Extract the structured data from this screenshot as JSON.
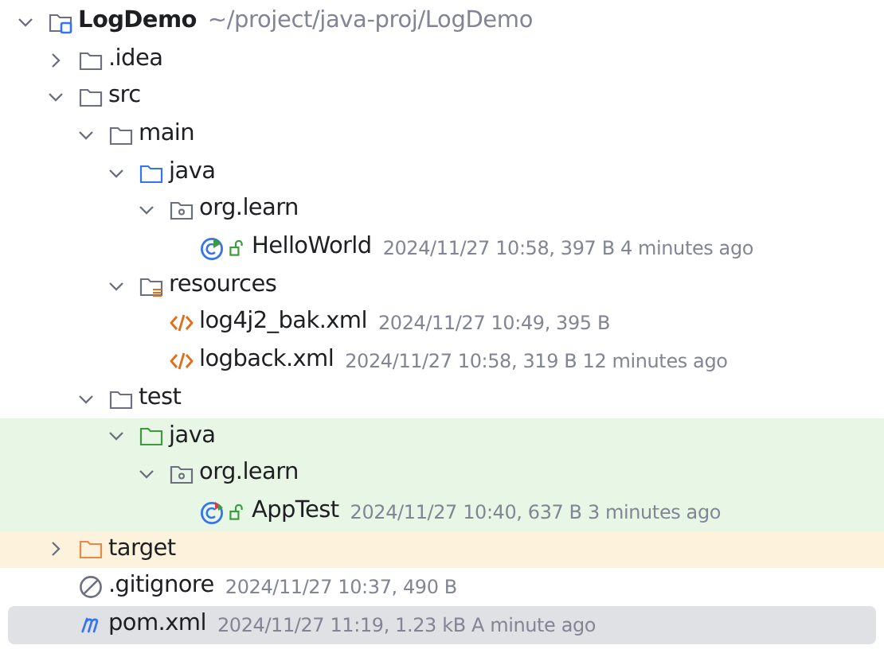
{
  "tree": [
    {
      "label": "LogDemo",
      "detail": "~/project/java-proj/LogDemo",
      "kind": "project",
      "expanded": true,
      "children": [
        {
          "label": ".idea",
          "kind": "folder",
          "expanded": false
        },
        {
          "label": "src",
          "kind": "folder",
          "expanded": true,
          "children": [
            {
              "label": "main",
              "kind": "folder",
              "expanded": true,
              "children": [
                {
                  "label": "java",
                  "kind": "source-folder",
                  "expanded": true,
                  "children": [
                    {
                      "label": "org.learn",
                      "kind": "package",
                      "expanded": true,
                      "children": [
                        {
                          "label": "HelloWorld",
                          "detail": "2024/11/27 10:58, 397 B 4 minutes ago",
                          "kind": "class"
                        }
                      ]
                    }
                  ]
                },
                {
                  "label": "resources",
                  "kind": "resources",
                  "expanded": true,
                  "children": [
                    {
                      "label": "log4j2_bak.xml",
                      "detail": "2024/11/27 10:49, 395 B",
                      "kind": "xml"
                    },
                    {
                      "label": "logback.xml",
                      "detail": "2024/11/27 10:58, 319 B 12 minutes ago",
                      "kind": "xml"
                    }
                  ]
                }
              ]
            },
            {
              "label": "test",
              "kind": "folder",
              "expanded": true,
              "children": [
                {
                  "label": "java",
                  "kind": "test-folder",
                  "color": "#e8f6e6",
                  "expanded": true,
                  "children": [
                    {
                      "label": "org.learn",
                      "kind": "package",
                      "color": "#e8f6e6",
                      "expanded": true,
                      "children": [
                        {
                          "label": "AppTest",
                          "detail": "2024/11/27 10:40, 637 B 3 minutes ago",
                          "kind": "test-class",
                          "color": "#e8f6e6"
                        }
                      ]
                    }
                  ]
                }
              ]
            }
          ]
        },
        {
          "label": "target",
          "kind": "excluded-folder",
          "color": "#fdf3dd",
          "expanded": false
        },
        {
          "label": ".gitignore",
          "detail": "2024/11/27 10:37, 490 B",
          "kind": "ignore",
          "selected": false
        },
        {
          "label": "pom.xml",
          "detail": "2024/11/27 11:19, 1.23 kB A minute ago",
          "kind": "maven",
          "selected": true
        }
      ]
    }
  ]
}
